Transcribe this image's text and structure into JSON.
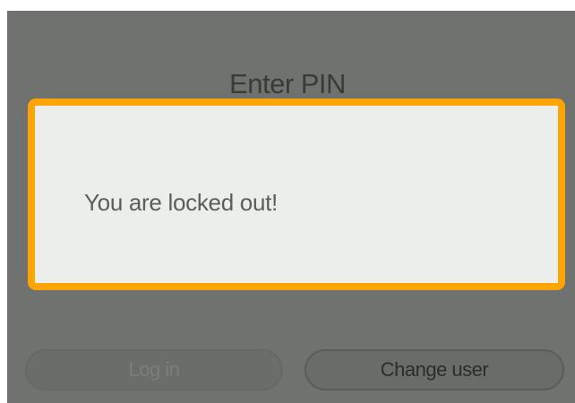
{
  "screen": {
    "title": "Enter PIN"
  },
  "dialog": {
    "message": "You are locked out!",
    "border_color": "#ffa400",
    "background_color": "#eceeeb"
  },
  "buttons": {
    "login_label": "Log in",
    "change_user_label": "Change user"
  },
  "colors": {
    "overlay": "#6f726e"
  }
}
